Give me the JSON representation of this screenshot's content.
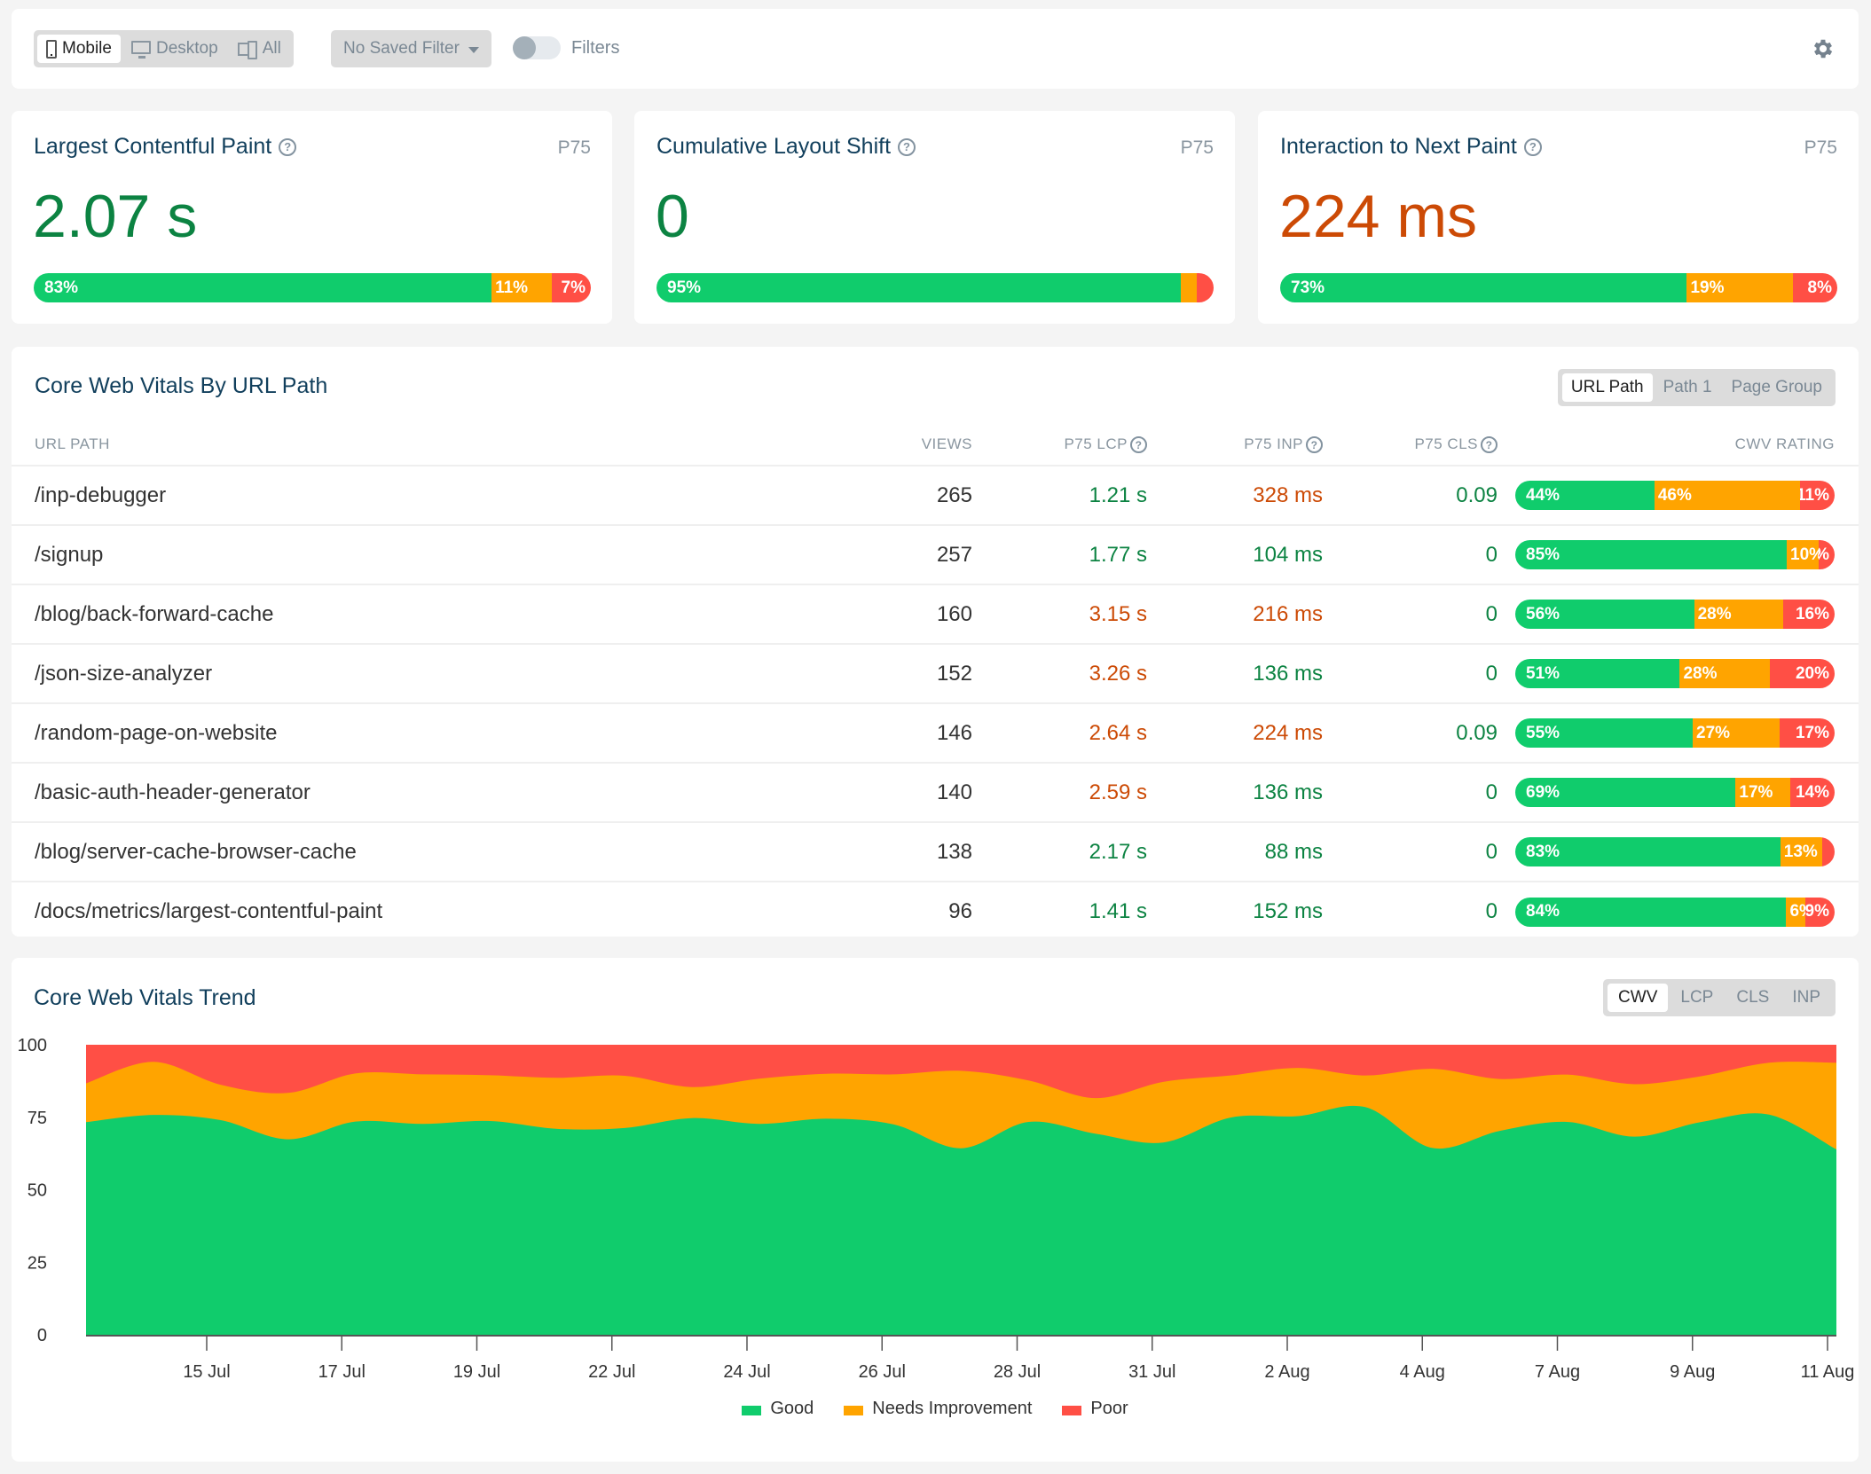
{
  "toolbar": {
    "device_options": [
      {
        "label": "Mobile",
        "icon": "mobile-icon",
        "active": true
      },
      {
        "label": "Desktop",
        "icon": "desktop-icon",
        "active": false
      },
      {
        "label": "All",
        "icon": "all-devices-icon",
        "active": false
      }
    ],
    "saved_filter": "No Saved Filter",
    "filters_label": "Filters",
    "filters_enabled": false,
    "settings_icon": "gear-icon"
  },
  "colors": {
    "good": "#10cc6c",
    "needs_improvement": "#ffa400",
    "poor": "#ff4f45",
    "good_text": "#0c8342",
    "ni_text": "#cc4a05",
    "title": "#113f5c"
  },
  "metrics": [
    {
      "id": "lcp",
      "title": "Largest Contentful Paint",
      "percentile": "P75",
      "value": "2.07 s",
      "status": "good",
      "distribution": {
        "good": 83,
        "ni": 11,
        "poor": 7
      },
      "labels": [
        "83%",
        "11%",
        "7%"
      ]
    },
    {
      "id": "cls",
      "title": "Cumulative Layout Shift",
      "percentile": "P75",
      "value": "0",
      "status": "good",
      "distribution": {
        "good": 95,
        "ni": 3,
        "poor": 3
      },
      "labels": [
        "95%",
        "",
        ""
      ]
    },
    {
      "id": "inp",
      "title": "Interaction to Next Paint",
      "percentile": "P75",
      "value": "224 ms",
      "status": "ni",
      "distribution": {
        "good": 73,
        "ni": 19,
        "poor": 8
      },
      "labels": [
        "73%",
        "19%",
        "8%"
      ]
    }
  ],
  "table": {
    "title": "Core Web Vitals By URL Path",
    "grouping_options": [
      {
        "label": "URL Path",
        "active": true
      },
      {
        "label": "Path 1",
        "active": false
      },
      {
        "label": "Page Group",
        "active": false
      }
    ],
    "columns": {
      "path": "URL PATH",
      "views": "VIEWS",
      "lcp": "P75 LCP",
      "inp": "P75 INP",
      "cls": "P75 CLS",
      "rating": "CWV RATING"
    },
    "rows": [
      {
        "path": "/inp-debugger",
        "views": "265",
        "lcp": "1.21 s",
        "lcp_status": "good",
        "inp": "328 ms",
        "inp_status": "ni",
        "cls": "0.09",
        "cls_status": "good",
        "rating": {
          "good": 44,
          "ni": 46,
          "poor": 11
        },
        "labels": [
          "44%",
          "46%",
          "11%"
        ]
      },
      {
        "path": "/signup",
        "views": "257",
        "lcp": "1.77 s",
        "lcp_status": "good",
        "inp": "104 ms",
        "inp_status": "good",
        "cls": "0",
        "cls_status": "neutral",
        "rating": {
          "good": 85,
          "ni": 10,
          "poor": 5
        },
        "labels": [
          "85%",
          "10%",
          "5%"
        ]
      },
      {
        "path": "/blog/back-forward-cache",
        "views": "160",
        "lcp": "3.15 s",
        "lcp_status": "ni",
        "inp": "216 ms",
        "inp_status": "ni",
        "cls": "0",
        "cls_status": "neutral",
        "rating": {
          "good": 56,
          "ni": 28,
          "poor": 16
        },
        "labels": [
          "56%",
          "28%",
          "16%"
        ]
      },
      {
        "path": "/json-size-analyzer",
        "views": "152",
        "lcp": "3.26 s",
        "lcp_status": "ni",
        "inp": "136 ms",
        "inp_status": "good",
        "cls": "0",
        "cls_status": "neutral",
        "rating": {
          "good": 51,
          "ni": 28,
          "poor": 20
        },
        "labels": [
          "51%",
          "28%",
          "20%"
        ]
      },
      {
        "path": "/random-page-on-website",
        "views": "146",
        "lcp": "2.64 s",
        "lcp_status": "ni",
        "inp": "224 ms",
        "inp_status": "ni",
        "cls": "0.09",
        "cls_status": "good",
        "rating": {
          "good": 55,
          "ni": 27,
          "poor": 17
        },
        "labels": [
          "55%",
          "27%",
          "17%"
        ]
      },
      {
        "path": "/basic-auth-header-generator",
        "views": "140",
        "lcp": "2.59 s",
        "lcp_status": "ni",
        "inp": "136 ms",
        "inp_status": "good",
        "cls": "0",
        "cls_status": "neutral",
        "rating": {
          "good": 69,
          "ni": 17,
          "poor": 14
        },
        "labels": [
          "69%",
          "17%",
          "14%"
        ]
      },
      {
        "path": "/blog/server-cache-browser-cache",
        "views": "138",
        "lcp": "2.17 s",
        "lcp_status": "good",
        "inp": "88 ms",
        "inp_status": "good",
        "cls": "0",
        "cls_status": "neutral",
        "rating": {
          "good": 83,
          "ni": 13,
          "poor": 4
        },
        "labels": [
          "83%",
          "13%",
          ""
        ]
      },
      {
        "path": "/docs/metrics/largest-contentful-paint",
        "views": "96",
        "lcp": "1.41 s",
        "lcp_status": "good",
        "inp": "152 ms",
        "inp_status": "good",
        "cls": "0",
        "cls_status": "neutral",
        "rating": {
          "good": 84,
          "ni": 6,
          "poor": 9
        },
        "labels": [
          "84%",
          "6%",
          "9%"
        ]
      }
    ]
  },
  "trend": {
    "title": "Core Web Vitals Trend",
    "metric_options": [
      {
        "label": "CWV",
        "active": true
      },
      {
        "label": "LCP",
        "active": false
      },
      {
        "label": "CLS",
        "active": false
      },
      {
        "label": "INP",
        "active": false
      }
    ]
  },
  "chart_data": {
    "type": "area",
    "stacked": true,
    "title": "Core Web Vitals Trend",
    "xlabel": "",
    "ylabel": "",
    "ylim": [
      0,
      100
    ],
    "yticks": [
      0,
      25,
      50,
      75,
      100
    ],
    "xtick_labels": [
      "15 Jul",
      "17 Jul",
      "19 Jul",
      "22 Jul",
      "24 Jul",
      "26 Jul",
      "28 Jul",
      "31 Jul",
      "2 Aug",
      "4 Aug",
      "7 Aug",
      "9 Aug",
      "11 Aug"
    ],
    "legend": {
      "position": "bottom",
      "entries": [
        "Good",
        "Needs Improvement",
        "Poor"
      ]
    },
    "grid": false,
    "point_count": 27,
    "series": [
      {
        "name": "Good",
        "color": "#10cc6c",
        "values": [
          73.3,
          75.8,
          74.0,
          67.4,
          73.5,
          72.7,
          73.7,
          71.0,
          71.3,
          74.7,
          72.7,
          74.5,
          72.5,
          64.3,
          73.4,
          69.3,
          66.3,
          74.9,
          75.4,
          78.5,
          64.4,
          70.3,
          73.4,
          68.3,
          73.4,
          75.9,
          63.9
        ]
      },
      {
        "name": "Needs Improvement",
        "color": "#ffa400",
        "values": [
          13.4,
          18.3,
          12.2,
          16.0,
          16.6,
          17.1,
          15.8,
          17.6,
          18.0,
          10.7,
          15.6,
          15.5,
          17.3,
          26.7,
          14.3,
          12.3,
          20.9,
          14.5,
          16.6,
          10.9,
          27.3,
          17.9,
          16.3,
          18.1,
          15.8,
          17.9,
          29.9
        ]
      },
      {
        "name": "Poor",
        "color": "#ff4f45",
        "values": [
          13.3,
          5.9,
          13.8,
          16.6,
          9.9,
          10.2,
          10.5,
          11.4,
          10.7,
          14.6,
          11.7,
          10.0,
          10.2,
          9.0,
          12.3,
          18.4,
          12.8,
          10.6,
          8.0,
          10.6,
          8.3,
          11.8,
          10.3,
          13.6,
          10.8,
          6.2,
          6.2
        ]
      }
    ]
  }
}
